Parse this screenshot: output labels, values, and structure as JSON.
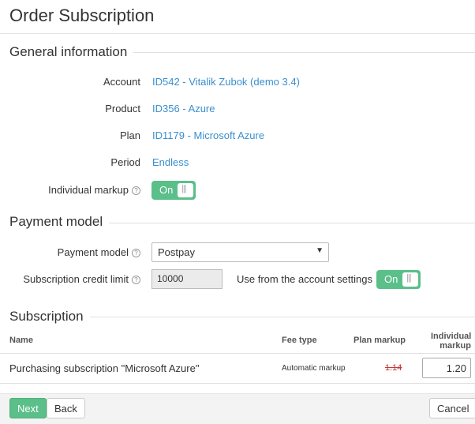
{
  "page": {
    "title": "Order Subscription"
  },
  "general": {
    "heading": "General information",
    "account_label": "Account",
    "account_value": "ID542 - Vitalik Zubok (demo 3.4)",
    "product_label": "Product",
    "product_value": "ID356 - Azure",
    "plan_label": "Plan",
    "plan_value": "ID1179 - Microsoft Azure",
    "period_label": "Period",
    "period_value": "Endless",
    "individual_markup_label": "Individual markup",
    "individual_markup_toggle": "On"
  },
  "payment": {
    "heading": "Payment model",
    "model_label": "Payment model",
    "model_value": "Postpay",
    "credit_limit_label": "Subscription credit limit",
    "credit_limit_value": "10000",
    "use_account_settings_label": "Use from the account settings",
    "use_account_settings_toggle": "On"
  },
  "subscription": {
    "heading": "Subscription",
    "columns": {
      "name": "Name",
      "fee_type": "Fee type",
      "plan_markup": "Plan markup",
      "individual_markup_line1": "Individual",
      "individual_markup_line2": "markup"
    },
    "rows": [
      {
        "name": "Purchasing subscription \"Microsoft Azure\"",
        "fee_type": "Automatic markup",
        "plan_markup": "1.14",
        "individual_markup": "1.20"
      }
    ]
  },
  "footer": {
    "next_label": "Next",
    "back_label": "Back",
    "cancel_label": "Cancel"
  },
  "colors": {
    "accent_green": "#5bbf8a",
    "link_blue": "#3a8fcf",
    "strike_red": "#cc3333"
  }
}
